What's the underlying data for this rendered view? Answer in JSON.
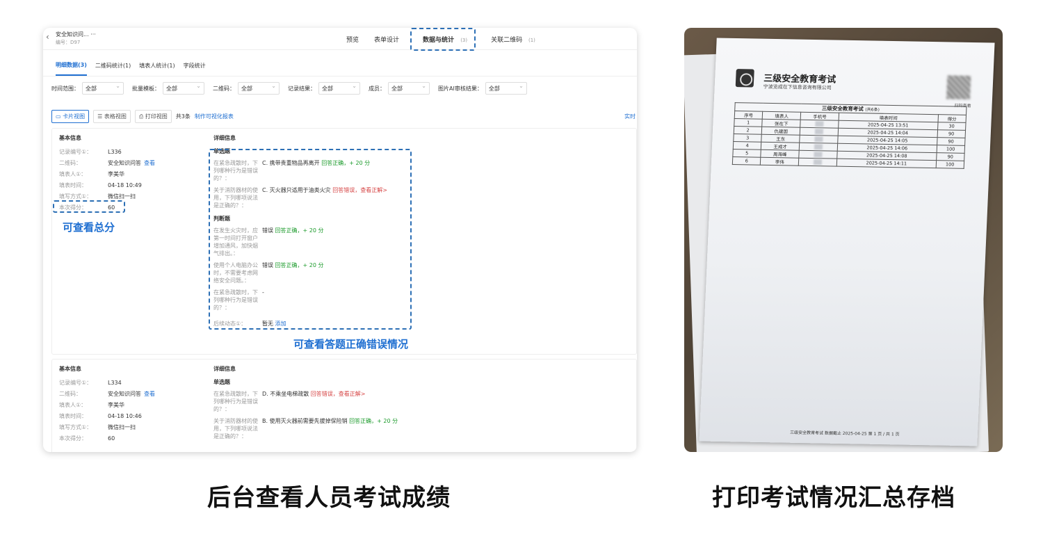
{
  "app": {
    "title": "安全知识问...",
    "more": "···",
    "code": "编号：D97"
  },
  "nav": [
    {
      "label": "预览"
    },
    {
      "label": "表单设计"
    },
    {
      "label": "数据与统计",
      "count": "(3)",
      "active": true
    },
    {
      "label": "关联二维码",
      "count": "(1)"
    }
  ],
  "subtabs": [
    {
      "label": "明细数据(3)",
      "active": true
    },
    {
      "label": "二维码统计(1)"
    },
    {
      "label": "填表人统计(1)"
    },
    {
      "label": "字段统计"
    }
  ],
  "filters": [
    {
      "label": "时间范围：",
      "value": "全部"
    },
    {
      "label": "批量模板：",
      "value": "全部"
    },
    {
      "label": "二维码：",
      "value": "全部"
    },
    {
      "label": "记录结果：",
      "value": "全部"
    },
    {
      "label": "成员：",
      "value": "全部"
    },
    {
      "label": "图片AI审核结果：",
      "value": "全部"
    }
  ],
  "viewbar": {
    "card_view": "卡片视图",
    "table_view": "表格视图",
    "print_view": "打印视图",
    "total": "共3条",
    "report_link": "制作可视化报表",
    "right_link": "实时"
  },
  "records": [
    {
      "basic_title": "基本信息",
      "fields": [
        {
          "k": "记录编号①：",
          "v": "L336"
        },
        {
          "k": "二维码：",
          "v": "安全知识问答",
          "link": "查看"
        },
        {
          "k": "填表人①：",
          "v": "李美华"
        },
        {
          "k": "填表时间：",
          "v": "04-18 10:49"
        },
        {
          "k": "填写方式①：",
          "v": "微信扫一扫"
        },
        {
          "k": "本次得分：",
          "v": "60"
        }
      ],
      "detail_title": "详细信息",
      "single_title": "单选题",
      "singles": [
        {
          "q": "在紧急疏散时，下列哪种行为是错误的？：",
          "a": "C. 携带贵重物品再离开",
          "r": "回答正确，+ 20 分",
          "ok": true
        },
        {
          "q": "关于消防器材的使用，下列哪项说法是正确的？：",
          "a": "C. 灭火器只适用于油类火灾",
          "r": "回答错误，查看正解>",
          "ok": false
        }
      ],
      "judge_title": "判断题",
      "judges": [
        {
          "q": "在发生火灾时，应第一时间打开窗户增加通风，加快烟气排出。：",
          "a": "错误",
          "r": "回答正确，+ 20 分",
          "ok": true
        },
        {
          "q": "使用个人电脑办公时，不需要考虑网络安全问题。：",
          "a": "错误",
          "r": "回答正确，+ 20 分",
          "ok": true
        },
        {
          "q": "在紧急疏散时，下列哪种行为是错误的？：",
          "a": "-",
          "r": "",
          "ok": true
        }
      ],
      "followup_label": "后续动态①：",
      "followup_value": "暂无",
      "followup_link": "添加"
    },
    {
      "basic_title": "基本信息",
      "fields": [
        {
          "k": "记录编号①：",
          "v": "L334"
        },
        {
          "k": "二维码：",
          "v": "安全知识问答",
          "link": "查看"
        },
        {
          "k": "填表人①：",
          "v": "李美华"
        },
        {
          "k": "填表时间：",
          "v": "04-18 10:46"
        },
        {
          "k": "填写方式①：",
          "v": "微信扫一扫"
        },
        {
          "k": "本次得分：",
          "v": "60"
        }
      ],
      "detail_title": "详细信息",
      "single_title": "单选题",
      "singles": [
        {
          "q": "在紧急疏散时，下列哪种行为是错误的？：",
          "a": "D. 不乘坐电梯疏散",
          "r": "回答错误，查看正解>",
          "ok": false
        },
        {
          "q": "关于消防器材的使用，下列哪项说法是正确的？：",
          "a": "B. 使用灭火器前需要先拔掉保险销",
          "r": "回答正确，+ 20 分",
          "ok": true
        }
      ]
    }
  ],
  "annotations": {
    "score_note": "可查看总分",
    "detail_note": "可查看答题正确错误情况"
  },
  "paper": {
    "title": "三级安全教育考试",
    "company": "宁波览成在下信息咨询有限公司",
    "qr_text": "扫码查看",
    "table_caption": "三级安全教育考试",
    "table_count": "(共6条)",
    "headers": [
      "序号",
      "填表人",
      "手机号",
      "填表时间",
      "得分"
    ],
    "rows": [
      [
        "1",
        "张在下",
        "",
        "2025-04-25 13:51",
        "30"
      ],
      [
        "2",
        "仇建国",
        "",
        "2025-04-25 14:04",
        "90"
      ],
      [
        "3",
        "王东",
        "",
        "2025-04-25 14:05",
        "90"
      ],
      [
        "4",
        "王成才",
        "",
        "2025-04-25 14:06",
        "100"
      ],
      [
        "5",
        "周海峰",
        "",
        "2025-04-25 14:08",
        "90"
      ],
      [
        "6",
        "李伟",
        "",
        "2025-04-25 14:11",
        "100"
      ]
    ],
    "footer": "三级安全教育考试   数据截止 2025-04-25   第 1 页 / 共 1 页"
  },
  "captions": {
    "left": "后台查看人员考试成绩",
    "right": "打印考试情况汇总存档"
  },
  "colors": {
    "accent": "#1f6fd1",
    "ok": "#1a9a2a",
    "bad": "#d64545"
  }
}
